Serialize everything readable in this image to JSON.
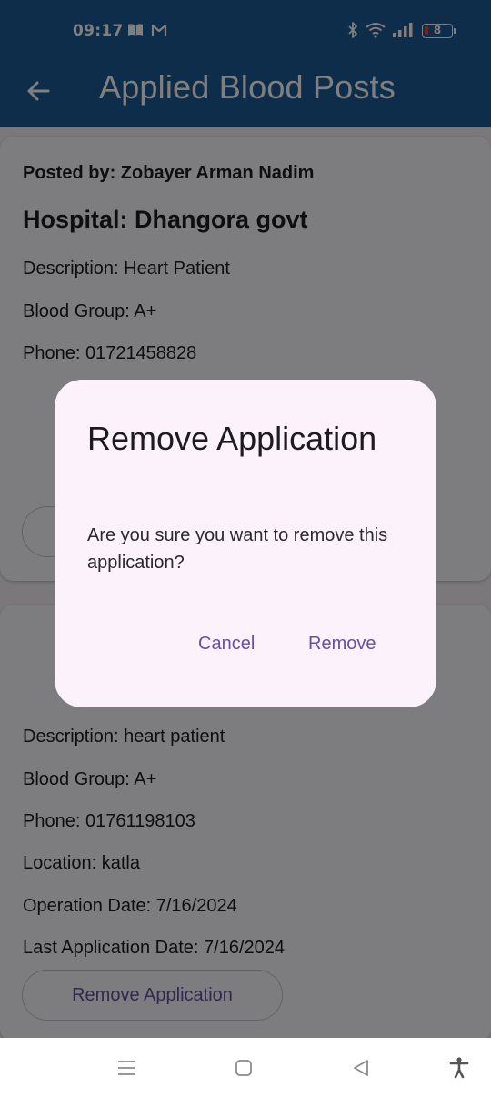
{
  "status_bar": {
    "time": "09:17",
    "battery_level": "8",
    "icons": [
      "book-icon",
      "gmail-icon",
      "bluetooth-icon",
      "wifi-icon",
      "signal-icon",
      "battery-icon"
    ]
  },
  "app_bar": {
    "title": "Applied Blood Posts",
    "back_icon": "arrow-back-icon",
    "color": "#1d5a94"
  },
  "posts": [
    {
      "posted_by": "Posted by: Zobayer Arman Nadim",
      "hospital": "Hospital: Dhangora govt",
      "description": "Description: Heart Patient",
      "blood_group": "Blood Group: A+",
      "phone": "Phone: 01721458828"
    },
    {
      "description": "Description: heart patient",
      "blood_group": "Blood Group: A+",
      "phone": "Phone: 01761198103",
      "location": "Location: katla",
      "operation_date": "Operation Date: 7/16/2024",
      "last_application_date": "Last Application Date: 7/16/2024",
      "action_label": "Remove Application"
    }
  ],
  "dialog": {
    "title": "Remove Application",
    "message": "Are you sure you want to remove this application?",
    "cancel_label": "Cancel",
    "confirm_label": "Remove"
  },
  "nav_bar": {
    "icons": [
      "menu-icon",
      "home-icon",
      "back-icon",
      "accessibility-icon"
    ]
  },
  "colors": {
    "accent": "#6750a4",
    "dialog_background": "#fbf2fb",
    "scrim": "rgba(0,0,0,0.5)"
  }
}
